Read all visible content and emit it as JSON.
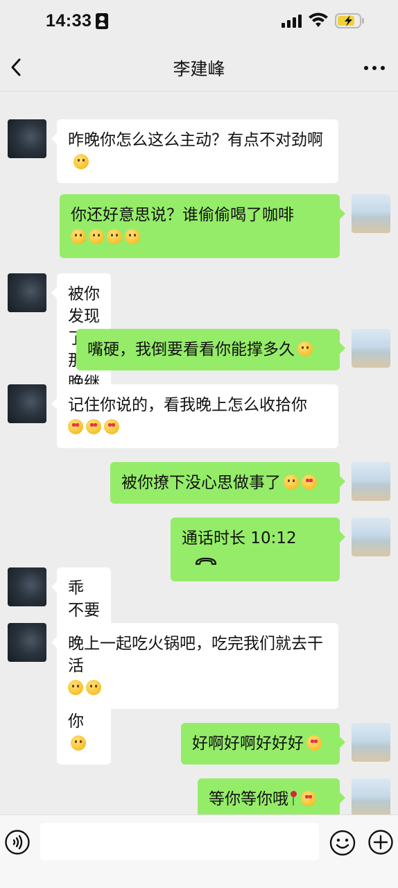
{
  "status_bar": {
    "time": "14:33"
  },
  "header": {
    "title": "李建峰"
  },
  "messages": [
    {
      "from": "them",
      "text": "昨晚你怎么这么主动？有点不对劲啊",
      "emojis": [
        "smirk"
      ]
    },
    {
      "from": "me",
      "text": "你还好意思说？谁偷偷喝了咖啡",
      "emojis": [
        "woozy",
        "grin",
        "grin",
        "grin"
      ]
    },
    {
      "from": "them",
      "text": "被你发现了？那今晚继续",
      "emojis": [
        "sleepy"
      ]
    },
    {
      "from": "me",
      "text": "嘴硬，我倒要看看你能撑多久",
      "emojis": [
        "hand"
      ]
    },
    {
      "from": "them",
      "text": "记住你说的，看我晚上怎么收拾你",
      "emojis": [
        "heart-eyes",
        "heart-eyes",
        "heart-eyes"
      ]
    },
    {
      "from": "me",
      "text": "被你撩下没心思做事了",
      "emojis": [
        "dizzy",
        "heart-eyes"
      ]
    },
    {
      "from": "me",
      "type": "call",
      "text": "通话时长 10:12",
      "icon": "hang-up-icon"
    },
    {
      "from": "them",
      "text": "乖 不要急，我忙完就去找你",
      "emojis": [
        "smile"
      ]
    },
    {
      "from": "them",
      "text": "晚上一起吃火锅吧，吃完我们就去干活",
      "emojis": [
        "thinking",
        "heart-hug"
      ]
    },
    {
      "from": "me",
      "text": "好啊好啊好好好",
      "emojis": [
        "heart-eyes"
      ]
    },
    {
      "from": "me",
      "text": "等你等你哦",
      "emojis": [
        "rose",
        "heart-eyes"
      ]
    }
  ],
  "input": {
    "placeholder": ""
  },
  "icons": {
    "back": "chevron-left-icon",
    "more": "more-dots-icon",
    "voice": "voice-icon",
    "emoji": "emoji-icon",
    "plus": "plus-icon"
  },
  "colors": {
    "outgoing_bubble": "#95ec69",
    "incoming_bubble": "#ffffff",
    "background": "#ededed"
  }
}
